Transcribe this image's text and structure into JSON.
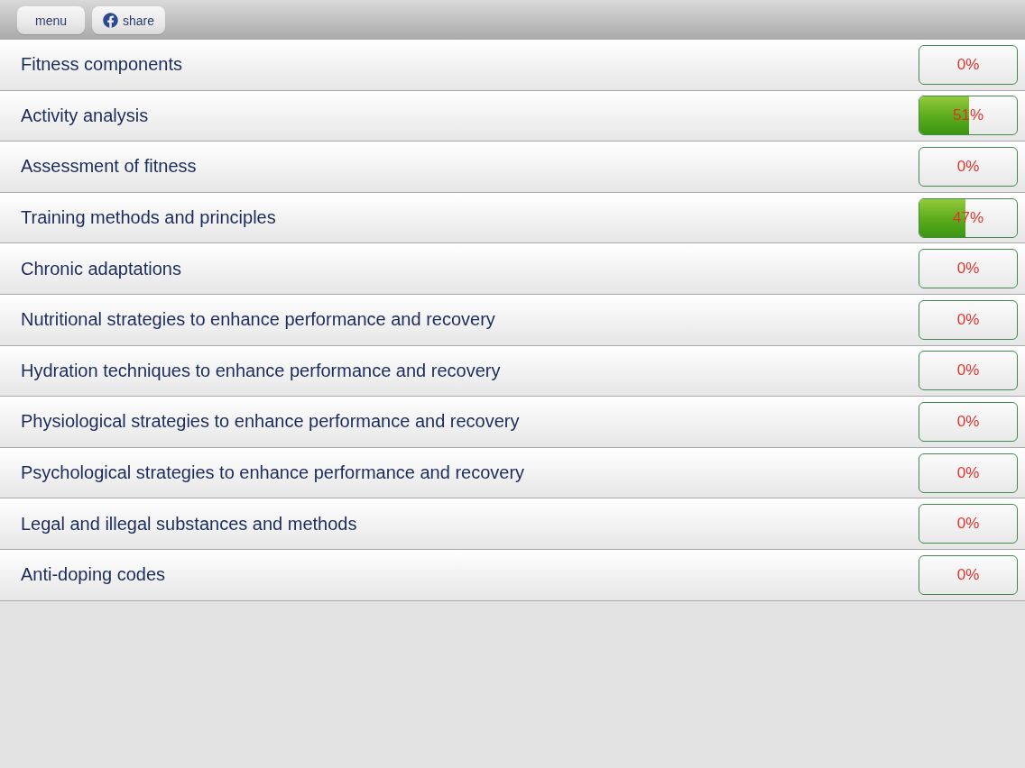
{
  "toolbar": {
    "buttons": [
      {
        "kind": "menu",
        "label": "menu"
      },
      {
        "kind": "share",
        "label": "share"
      }
    ]
  },
  "topics": [
    {
      "title": "Fitness components",
      "level": 0,
      "percent": "0%"
    },
    {
      "title": "Activity analysis",
      "level": 0.51,
      "percent": "51%"
    },
    {
      "title": "Assessment of fitness",
      "level": 0,
      "percent": "0%"
    },
    {
      "title": "Training methods and principles",
      "level": 0.47,
      "percent": "47%"
    },
    {
      "title": "Chronic adaptations",
      "level": 0,
      "percent": "0%"
    },
    {
      "title": "Nutritional strategies to enhance performance and recovery",
      "level": 0,
      "percent": "0%"
    },
    {
      "title": "Hydration techniques to enhance performance and recovery",
      "level": 0,
      "percent": "0%"
    },
    {
      "title": "Physiological strategies to enhance performance and recovery",
      "level": 0,
      "percent": "0%"
    },
    {
      "title": "Psychological strategies to enhance performance and recovery",
      "level": 0,
      "percent": "0%"
    },
    {
      "title": "Legal and illegal substances and methods",
      "level": 0,
      "percent": "0%"
    },
    {
      "title": "Anti-doping codes",
      "level": 0,
      "percent": "0%"
    }
  ]
}
